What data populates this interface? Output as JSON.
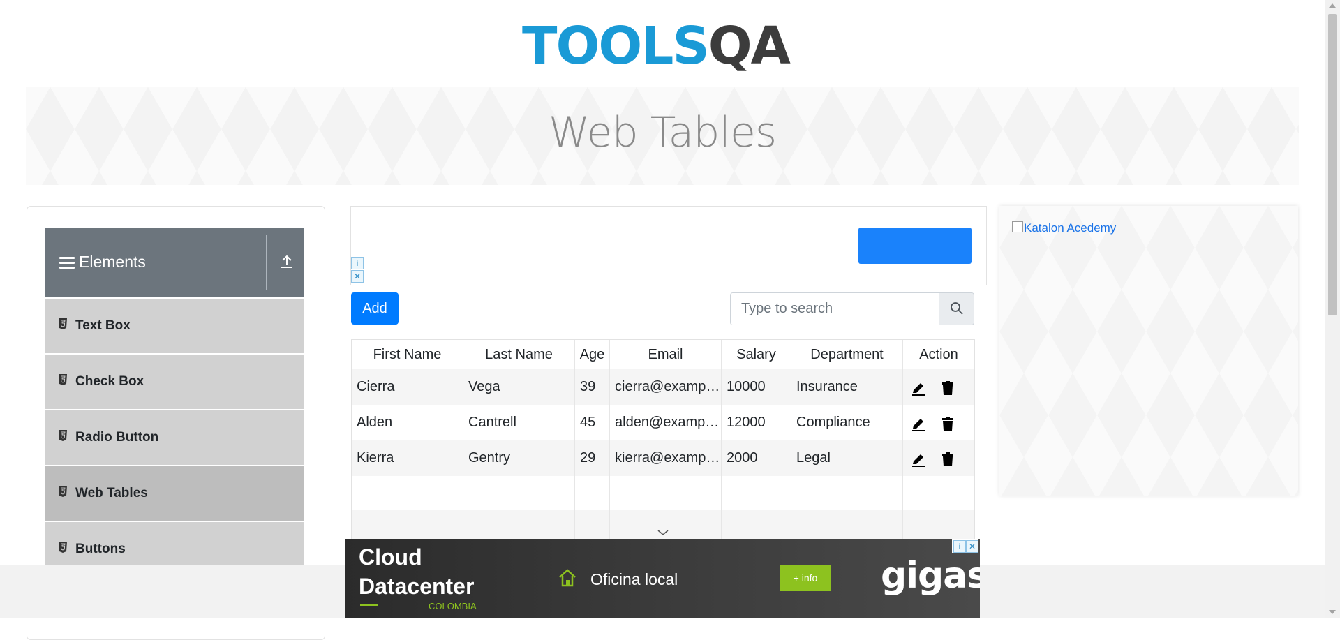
{
  "header": {
    "logo_text_tools": "TOOLS",
    "logo_text_qa": "QA",
    "page_title": "Web Tables"
  },
  "sidebar": {
    "group_title": "Elements",
    "items": [
      {
        "label": "Text Box",
        "icon": "html5-icon"
      },
      {
        "label": "Check Box",
        "icon": "html5-icon"
      },
      {
        "label": "Radio Button",
        "icon": "html5-icon"
      },
      {
        "label": "Web Tables",
        "icon": "html5-icon",
        "active": true
      },
      {
        "label": "Buttons",
        "icon": "html5-icon"
      }
    ]
  },
  "toolbar": {
    "add_label": "Add",
    "search_placeholder": "Type to search",
    "search_value": ""
  },
  "table": {
    "columns": [
      "First Name",
      "Last Name",
      "Age",
      "Email",
      "Salary",
      "Department",
      "Action"
    ],
    "rows": [
      {
        "first": "Cierra",
        "last": "Vega",
        "age": "39",
        "email": "cierra@example.com",
        "salary": "10000",
        "department": "Insurance"
      },
      {
        "first": "Alden",
        "last": "Cantrell",
        "age": "45",
        "email": "alden@example.com",
        "salary": "12000",
        "department": "Compliance"
      },
      {
        "first": "Kierra",
        "last": "Gentry",
        "age": "29",
        "email": "kierra@example.com",
        "salary": "2000",
        "department": "Legal"
      }
    ]
  },
  "right_ad": {
    "alt_text": "Katalon Acedemy"
  },
  "bottom_ad": {
    "line1": "Cloud",
    "line2": "Datacenter",
    "country": "COLOMBIA",
    "office": "Oficina local",
    "info_button": "+ info",
    "brand": "gigas"
  },
  "colors": {
    "accent": "#007bff",
    "nav_header": "#6c757d",
    "nav_item": "#d1d1d1",
    "ad_green": "#8dc21f",
    "logo_blue": "#1a9ad6"
  }
}
